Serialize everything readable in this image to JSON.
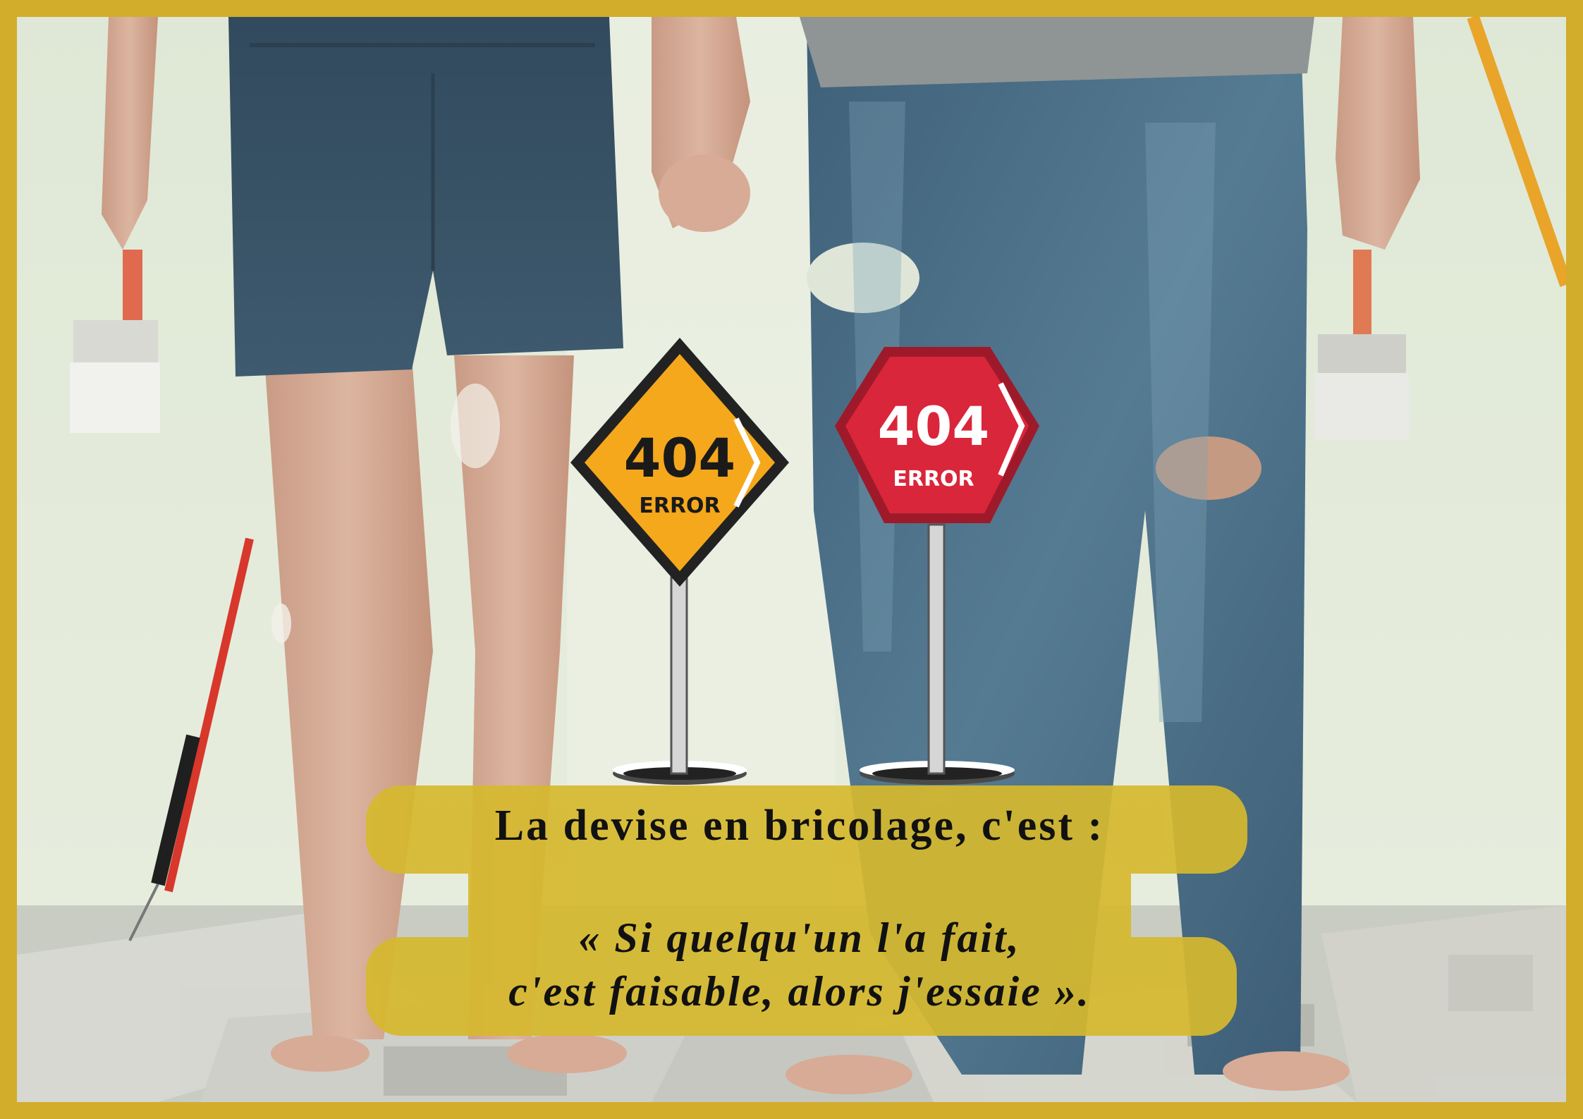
{
  "colors": {
    "frame": "#d2ad2b",
    "caption_band": "#d6b92e",
    "yellow_sign": "#f5a81c",
    "red_sign": "#d9263a"
  },
  "signs": {
    "yellow": {
      "number": "404",
      "word": "ERROR",
      "icon": "warning-diamond-icon"
    },
    "red": {
      "number": "404",
      "word": "ERROR",
      "icon": "stop-octagon-icon"
    }
  },
  "caption": {
    "line1": "La devise en bricolage, c'est :",
    "line2": "« Si quelqu'un l'a fait,",
    "line3": "c'est faisable, alors j'essaie »."
  }
}
